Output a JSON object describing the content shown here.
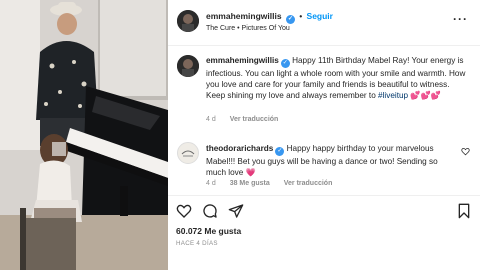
{
  "post": {
    "username": "emmahemingwillis",
    "follow_label": "Seguir",
    "separator": "•",
    "song": "The Cure • Pictures Of You",
    "more_label": "···"
  },
  "caption": {
    "username": "emmahemingwillis",
    "text": "Happy 11th Birthday Mabel Ray! Your energy is infectious. You can light a whole room with your smile and warmth. How you love and care for your family and friends is beautiful to witness. Keep shining my love and always remember to",
    "hashtag": "#liveitup",
    "emojis": "💕💕💕",
    "time": "4 d",
    "translate_label": "Ver traducción"
  },
  "comment": {
    "username": "theodorarichards",
    "text": "Happy happy birthday to your marvelous Mabel!!! Bet you guys will be having a dance or two! Sending so much love",
    "emoji": "💗",
    "time": "4 d",
    "likes_label": "38 Me gusta",
    "translate_label": "Ver traducción"
  },
  "actions": {
    "icons": [
      "heart-icon",
      "comment-icon",
      "share-icon",
      "bookmark-icon"
    ]
  },
  "stats": {
    "likes": "60.072 Me gusta",
    "posted": "HACE 4 DÍAS"
  },
  "colors": {
    "accent": "#0095f6",
    "verified": "#3897f0",
    "muted": "#8e8e8e",
    "hashtag": "#00376b"
  }
}
